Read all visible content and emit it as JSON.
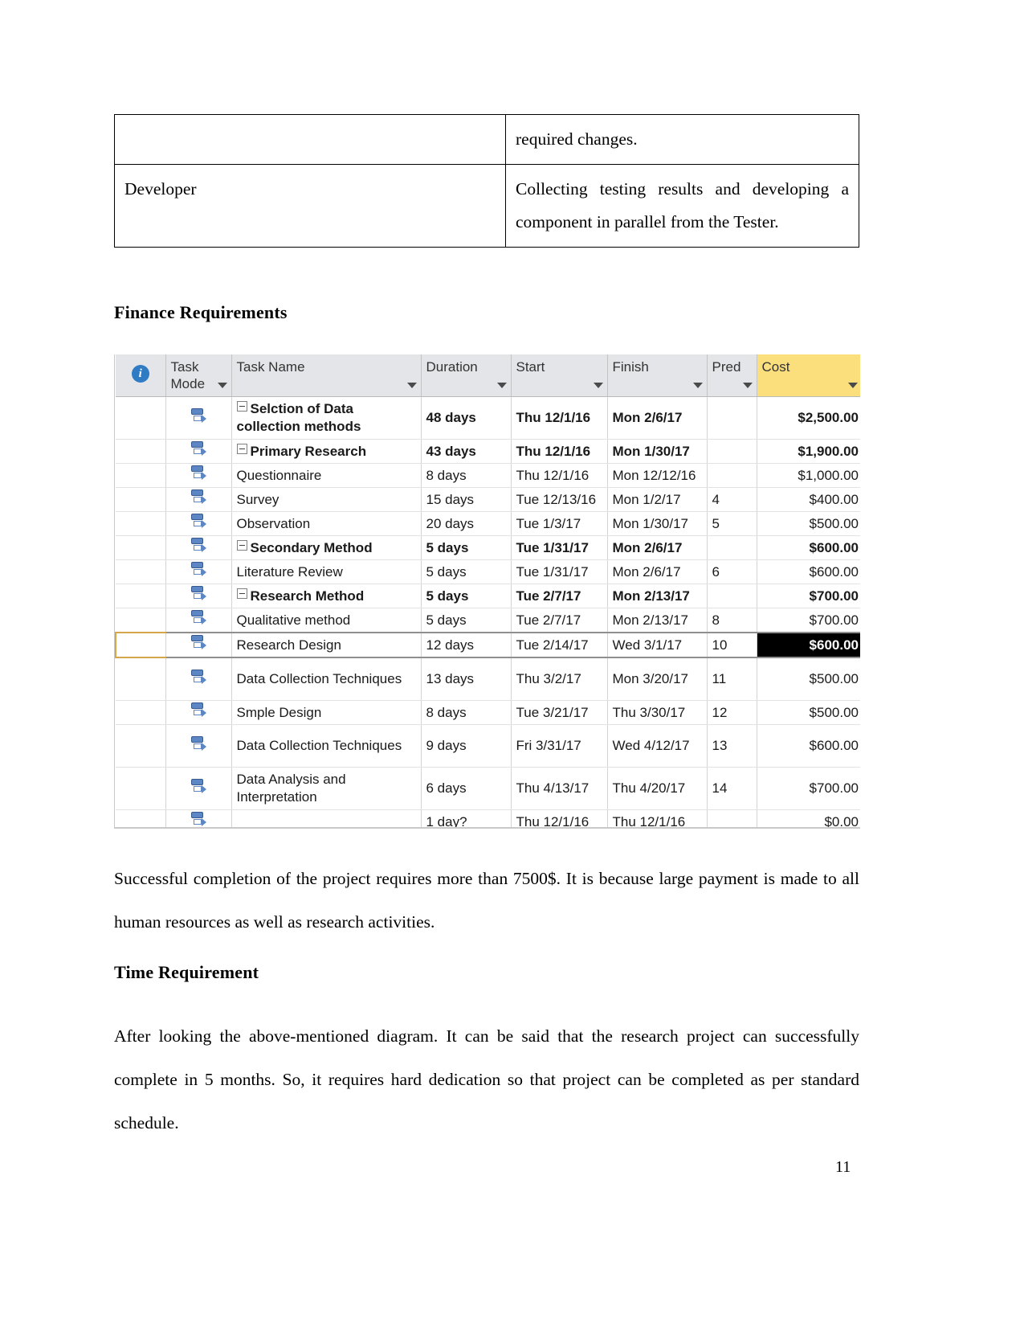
{
  "top_table": {
    "rows": [
      {
        "left": "",
        "right": "required changes."
      },
      {
        "left": "Developer",
        "right": "Collecting testing results and developing a component in parallel from the Tester."
      }
    ]
  },
  "headings": {
    "finance": "Finance Requirements",
    "time": "Time Requirement"
  },
  "paragraphs": {
    "finance": "Successful completion of the project requires more than 7500$. It is because large payment is made to all human resources as well as research activities.",
    "time": "After looking the above-mentioned diagram. It can be said that the research project can successfully complete in 5 months. So, it requires hard dedication so that project can be completed as per standard schedule."
  },
  "page_number": "11",
  "project_view": {
    "colors": {
      "header_background": "#e4e5e8",
      "cost_header_highlight": "#fcdf7d",
      "task_mode_icon": "#5c86c4",
      "info_icon": "#2f7bc4",
      "selection_fill": "#000000"
    },
    "columns": [
      {
        "key": "info",
        "label": "",
        "icon": "information-icon",
        "has_filter": false
      },
      {
        "key": "mode",
        "label": "Task Mode",
        "has_filter": true
      },
      {
        "key": "name",
        "label": "Task Name",
        "has_filter": true
      },
      {
        "key": "duration",
        "label": "Duration",
        "has_filter": true
      },
      {
        "key": "start",
        "label": "Start",
        "has_filter": true
      },
      {
        "key": "finish",
        "label": "Finish",
        "has_filter": true
      },
      {
        "key": "pred",
        "label": "Pred",
        "has_filter": true
      },
      {
        "key": "cost",
        "label": "Cost",
        "has_filter": true,
        "highlight": true
      }
    ],
    "rows": [
      {
        "name": "Selction of Data collection methods",
        "duration": "48 days",
        "start": "Thu 12/1/16",
        "finish": "Mon 2/6/17",
        "pred": "",
        "cost": "$2,500.00",
        "indent": 0,
        "summary": true,
        "collapsible": true,
        "tall": true
      },
      {
        "name": "Primary Research",
        "duration": "43 days",
        "start": "Thu 12/1/16",
        "finish": "Mon 1/30/17",
        "pred": "",
        "cost": "$1,900.00",
        "indent": 1,
        "summary": true,
        "collapsible": true,
        "tall": false
      },
      {
        "name": "Questionnaire",
        "duration": "8 days",
        "start": "Thu 12/1/16",
        "finish": "Mon 12/12/16",
        "pred": "",
        "cost": "$1,000.00",
        "indent": 2,
        "summary": false,
        "collapsible": false,
        "tall": false
      },
      {
        "name": "Survey",
        "duration": "15 days",
        "start": "Tue 12/13/16",
        "finish": "Mon 1/2/17",
        "pred": "4",
        "cost": "$400.00",
        "indent": 2,
        "summary": false,
        "collapsible": false,
        "tall": false
      },
      {
        "name": "Observation",
        "duration": "20 days",
        "start": "Tue 1/3/17",
        "finish": "Mon 1/30/17",
        "pred": "5",
        "cost": "$500.00",
        "indent": 2,
        "summary": false,
        "collapsible": false,
        "tall": false
      },
      {
        "name": "Secondary Method",
        "duration": "5 days",
        "start": "Tue 1/31/17",
        "finish": "Mon 2/6/17",
        "pred": "",
        "cost": "$600.00",
        "indent": 1,
        "summary": true,
        "collapsible": true,
        "tall": false
      },
      {
        "name": "Literature Review",
        "duration": "5 days",
        "start": "Tue 1/31/17",
        "finish": "Mon 2/6/17",
        "pred": "6",
        "cost": "$600.00",
        "indent": 2,
        "summary": false,
        "collapsible": false,
        "tall": false
      },
      {
        "name": "Research Method",
        "duration": "5 days",
        "start": "Tue 2/7/17",
        "finish": "Mon 2/13/17",
        "pred": "",
        "cost": "$700.00",
        "indent": 0,
        "summary": true,
        "collapsible": true,
        "tall": false
      },
      {
        "name": "Qualitative method",
        "duration": "5 days",
        "start": "Tue 2/7/17",
        "finish": "Mon 2/13/17",
        "pred": "8",
        "cost": "$700.00",
        "indent": 2,
        "summary": false,
        "collapsible": false,
        "tall": false
      },
      {
        "name": "Research Design",
        "duration": "12 days",
        "start": "Tue 2/14/17",
        "finish": "Wed 3/1/17",
        "pred": "10",
        "cost": "$600.00",
        "indent": 1,
        "summary": false,
        "collapsible": false,
        "tall": false,
        "selected": true
      },
      {
        "name": "Data Collection Techniques",
        "duration": "13 days",
        "start": "Thu 3/2/17",
        "finish": "Mon 3/20/17",
        "pred": "11",
        "cost": "$500.00",
        "indent": 1,
        "summary": false,
        "collapsible": false,
        "tall": true
      },
      {
        "name": "Smple Design",
        "duration": "8 days",
        "start": "Tue 3/21/17",
        "finish": "Thu 3/30/17",
        "pred": "12",
        "cost": "$500.00",
        "indent": 1,
        "summary": false,
        "collapsible": false,
        "tall": false
      },
      {
        "name": "Data Collection Techniques",
        "duration": "9 days",
        "start": "Fri 3/31/17",
        "finish": "Wed 4/12/17",
        "pred": "13",
        "cost": "$600.00",
        "indent": 1,
        "summary": false,
        "collapsible": false,
        "tall": true
      },
      {
        "name": "Data Analysis and Interpretation",
        "duration": "6 days",
        "start": "Thu 4/13/17",
        "finish": "Thu 4/20/17",
        "pred": "14",
        "cost": "$700.00",
        "indent": 1,
        "summary": false,
        "collapsible": false,
        "tall": true
      },
      {
        "name": "",
        "duration": "1 day?",
        "start": "Thu 12/1/16",
        "finish": "Thu 12/1/16",
        "pred": "",
        "cost": "$0.00",
        "indent": 1,
        "summary": false,
        "collapsible": false,
        "tall": false
      }
    ]
  }
}
